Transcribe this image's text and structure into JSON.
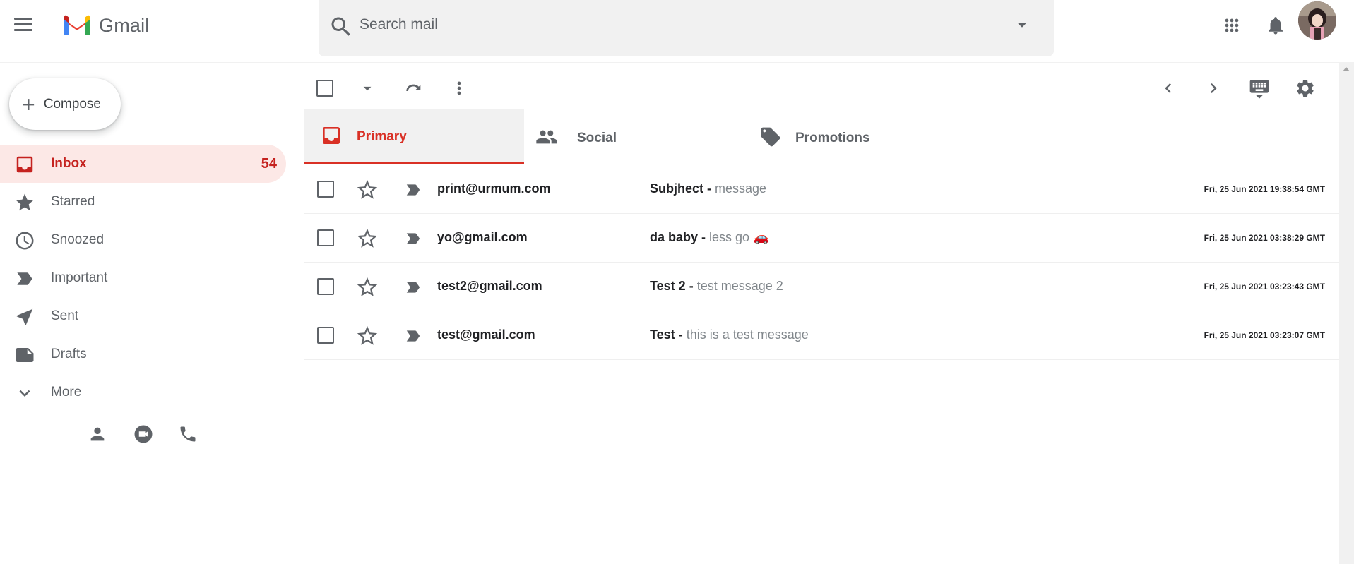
{
  "app": {
    "name": "Gmail"
  },
  "colors": {
    "brand_red": "#d93025",
    "active_nav_bg": "#fce8e6",
    "active_nav_text": "#c5221f",
    "icon_gray": "#5f6368",
    "search_bg": "#f1f1f1"
  },
  "header": {
    "menu_icon": "hamburger-menu-icon",
    "logo_text": "Gmail",
    "search": {
      "placeholder": "Search mail",
      "value": "",
      "icon": "search-icon",
      "options_icon": "dropdown-arrow-icon"
    },
    "right_icons": [
      "apps-grid-icon",
      "notifications-bell-icon",
      "avatar"
    ]
  },
  "sidebar": {
    "compose_label": "Compose",
    "items": [
      {
        "label": "Inbox",
        "count": "54",
        "icon": "inbox-icon",
        "active": true
      },
      {
        "label": "Starred",
        "count": "",
        "icon": "star-icon",
        "active": false
      },
      {
        "label": "Snoozed",
        "count": "",
        "icon": "clock-icon",
        "active": false
      },
      {
        "label": "Important",
        "count": "",
        "icon": "important-label-icon",
        "active": false
      },
      {
        "label": "Sent",
        "count": "",
        "icon": "send-icon",
        "active": false
      },
      {
        "label": "Drafts",
        "count": "",
        "icon": "draft-note-icon",
        "active": false
      },
      {
        "label": "More",
        "count": "",
        "icon": "chevron-down-icon",
        "active": false
      }
    ],
    "bottom_icons": [
      "person-icon",
      "meet-video-icon",
      "phone-icon"
    ]
  },
  "toolbar": {
    "left_icons": [
      "select-all-checkbox",
      "select-dropdown-icon",
      "refresh-icon",
      "more-vert-icon"
    ],
    "right_icons": [
      "chevron-left-icon",
      "chevron-right-icon",
      "keyboard-icon",
      "settings-gear-icon"
    ]
  },
  "tabs": [
    {
      "label": "Primary",
      "icon": "inbox-tab-icon",
      "active": true
    },
    {
      "label": "Social",
      "icon": "people-icon",
      "active": false
    },
    {
      "label": "Promotions",
      "icon": "tag-icon",
      "active": false
    }
  ],
  "emails": [
    {
      "sender": "print@urmum.com",
      "subject": "Subjhect",
      "separator": " - ",
      "snippet": "message",
      "date": "Fri, 25 Jun 2021 19:38:54 GMT"
    },
    {
      "sender": "yo@gmail.com",
      "subject": "da baby",
      "separator": " - ",
      "snippet": "less go 🚗",
      "date": "Fri, 25 Jun 2021 03:38:29 GMT"
    },
    {
      "sender": "test2@gmail.com",
      "subject": "Test 2",
      "separator": " - ",
      "snippet": "test message 2",
      "date": "Fri, 25 Jun 2021 03:23:43 GMT"
    },
    {
      "sender": "test@gmail.com",
      "subject": "Test",
      "separator": " - ",
      "snippet": "this is a test message",
      "date": "Fri, 25 Jun 2021 03:23:07 GMT"
    }
  ]
}
